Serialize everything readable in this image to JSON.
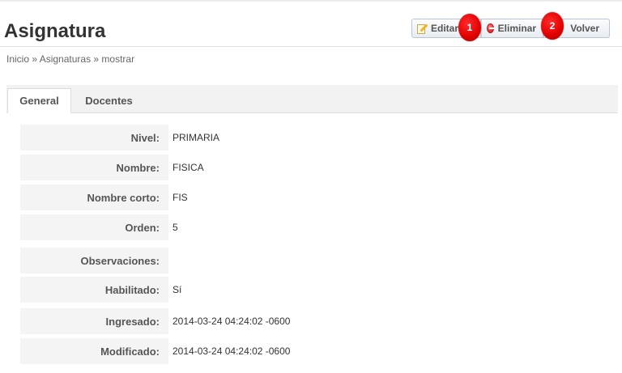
{
  "header": {
    "title": "Asignatura",
    "actions": {
      "edit_label": "Editar",
      "delete_label": "Eliminar",
      "back_label": "Volver"
    },
    "markers": [
      "1",
      "2"
    ]
  },
  "breadcrumb": "Inicio » Asignaturas » mostrar",
  "tabs": [
    {
      "label": "General",
      "active": true
    },
    {
      "label": "Docentes",
      "active": false
    }
  ],
  "fields": [
    {
      "label": "Nivel:",
      "value": "PRIMARIA"
    },
    {
      "label": "Nombre:",
      "value": "FISICA"
    },
    {
      "label": "Nombre corto:",
      "value": "FIS"
    },
    {
      "label": "Orden:",
      "value": "5"
    },
    {
      "label": "Observaciones:",
      "value": ""
    },
    {
      "label": "Habilitado:",
      "value": "Sí"
    },
    {
      "label": "Ingresado:",
      "value": "2014-03-24 04:24:02 -0600"
    },
    {
      "label": "Modificado:",
      "value": "2014-03-24 04:24:02 -0600"
    }
  ],
  "colors": {
    "marker": "#e00000",
    "button_border": "#b8c6d6"
  },
  "icons": {
    "edit": "pencil-icon",
    "delete": "minus-circle-icon"
  }
}
